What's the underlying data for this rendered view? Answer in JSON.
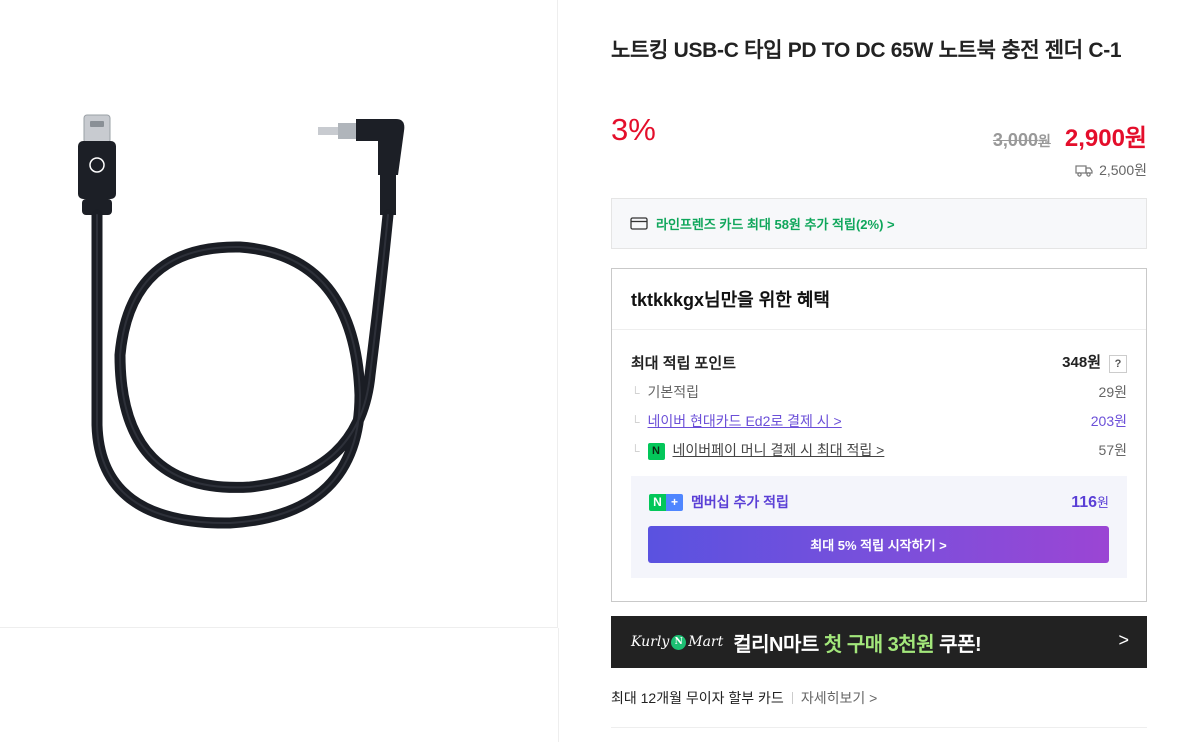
{
  "product": {
    "title": "노트킹 USB-C 타입 PD TO DC 65W 노트북 충전 젠더 C-1",
    "image_alt": "usb-c-to-dc-cable",
    "discount_rate": "3%",
    "original_price": "3,000",
    "original_unit": "원",
    "sale_price": "2,900원",
    "shipping_fee": "2,500원"
  },
  "card_banner": {
    "text": "라인프렌즈 카드 최대 58원 추가 적립(2%) >"
  },
  "benefits": {
    "header": "tktkkkgx님만을 위한 혜택",
    "max_point_label": "최대 적립 포인트",
    "max_point_value": "348원",
    "help_label": "?",
    "rows": [
      {
        "label": "기본적립",
        "value": "29원"
      },
      {
        "label": "네이버 현대카드 Ed2로 결제 시 >",
        "value": "203원"
      },
      {
        "label": "네이버페이 머니 결제 시 최대 적립 >",
        "value": "57원"
      }
    ],
    "membership": {
      "label": "멤버십 추가 적립",
      "value": "116",
      "unit": "원",
      "button": "최대 5% 적립 시작하기 >"
    }
  },
  "kurly": {
    "logo_left": "Kurly",
    "logo_dot": "N",
    "logo_right": "Mart",
    "text_prefix": "컬리N마트 ",
    "text_highlight": "첫 구매 3천원",
    "text_suffix": " 쿠폰!",
    "arrow": ">"
  },
  "installment": {
    "text": "최대 12개월 무이자 할부 카드",
    "more": "자세히보기 >"
  },
  "colors": {
    "accent_red": "#e40e2b",
    "naver_green": "#03c75a",
    "membership_purple": "#5a3fd6"
  }
}
